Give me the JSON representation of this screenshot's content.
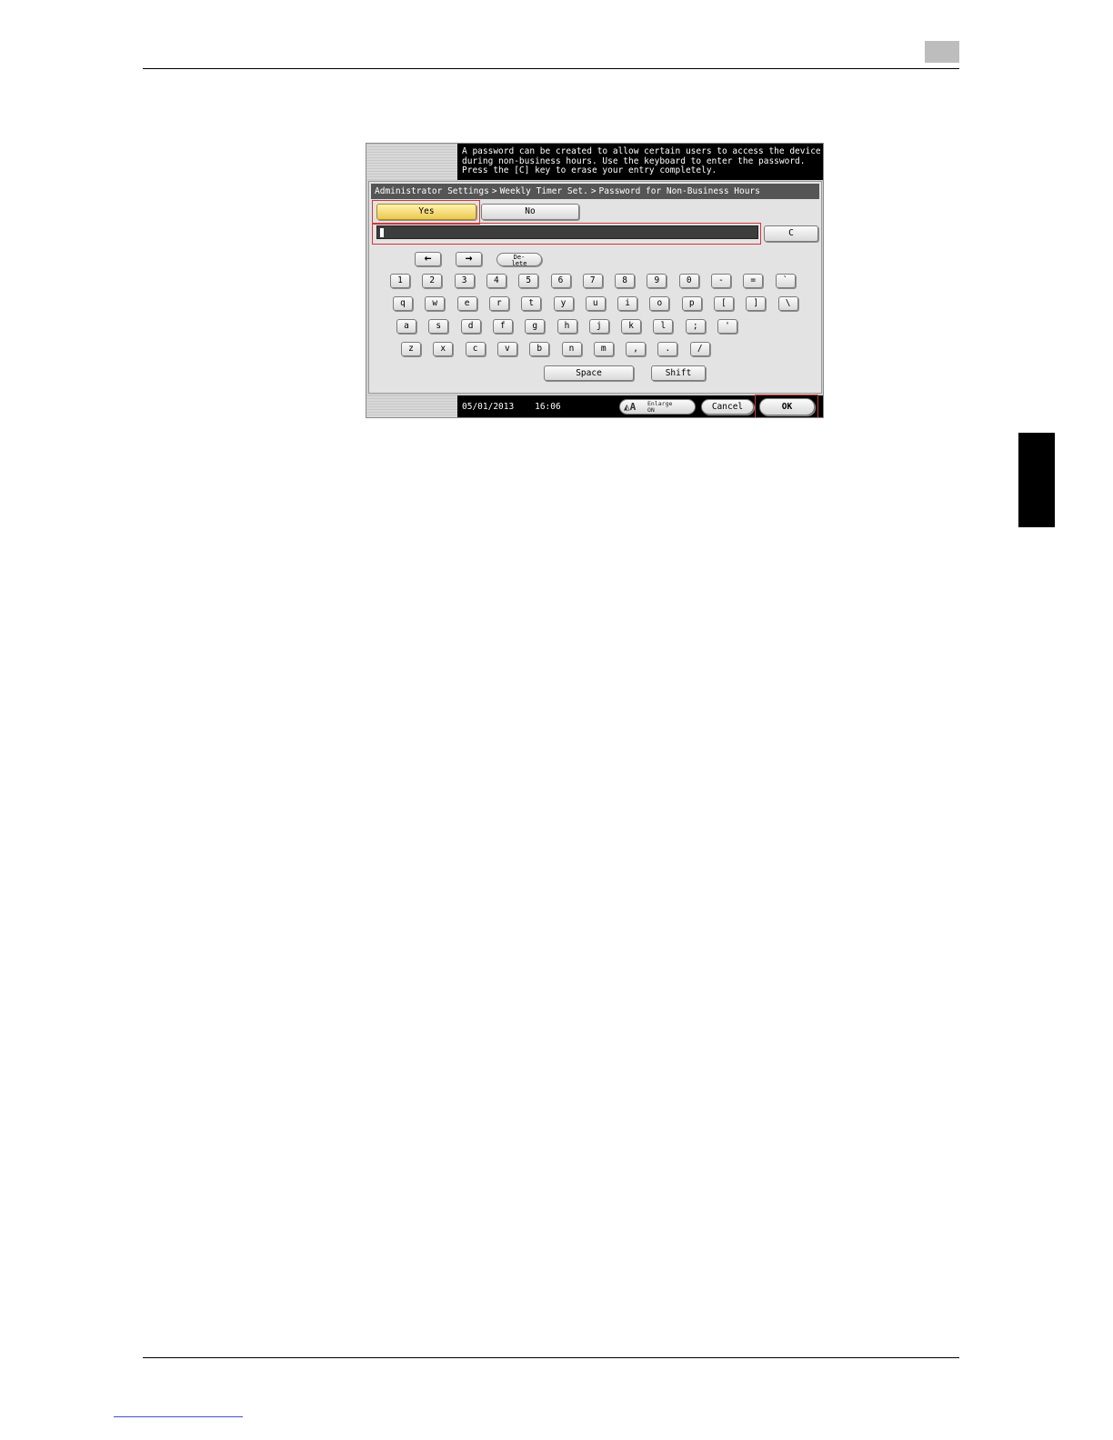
{
  "message": "A password can be created to allow certain users to access the device\nduring non-business hours. Use the keyboard to enter the password.\nPress the [C] key to erase your entry completely.",
  "breadcrumb": [
    "Administrator Settings",
    "Weekly Timer Set.",
    "Password for Non-Business Hours"
  ],
  "breadcrumb_separator": ">",
  "toggle": {
    "yes": "Yes",
    "no": "No",
    "selected": "Yes"
  },
  "password": {
    "value": ""
  },
  "clear_label": "C",
  "nav": {
    "left": "←",
    "right": "→",
    "delete": "De-\nlete"
  },
  "keyboard": {
    "rows": [
      [
        "1",
        "2",
        "3",
        "4",
        "5",
        "6",
        "7",
        "8",
        "9",
        "0",
        "-",
        "=",
        "`"
      ],
      [
        "q",
        "w",
        "e",
        "r",
        "t",
        "y",
        "u",
        "i",
        "o",
        "p",
        "[",
        "]",
        "\\"
      ],
      [
        "a",
        "s",
        "d",
        "f",
        "g",
        "h",
        "j",
        "k",
        "l",
        ";",
        "'"
      ],
      [
        "z",
        "x",
        "c",
        "v",
        "b",
        "n",
        "m",
        ",",
        ".",
        "/"
      ]
    ],
    "space": "Space",
    "shift": "Shift"
  },
  "status": {
    "date": "05/01/2013",
    "time": "16:06"
  },
  "enlarge": {
    "label": "Enlarge\nON"
  },
  "footer_buttons": {
    "cancel": "Cancel",
    "ok": "OK"
  },
  "colors": {
    "highlight": "#d03838",
    "selected": "#ecc850",
    "screen_bg": "#cfcfcf"
  }
}
